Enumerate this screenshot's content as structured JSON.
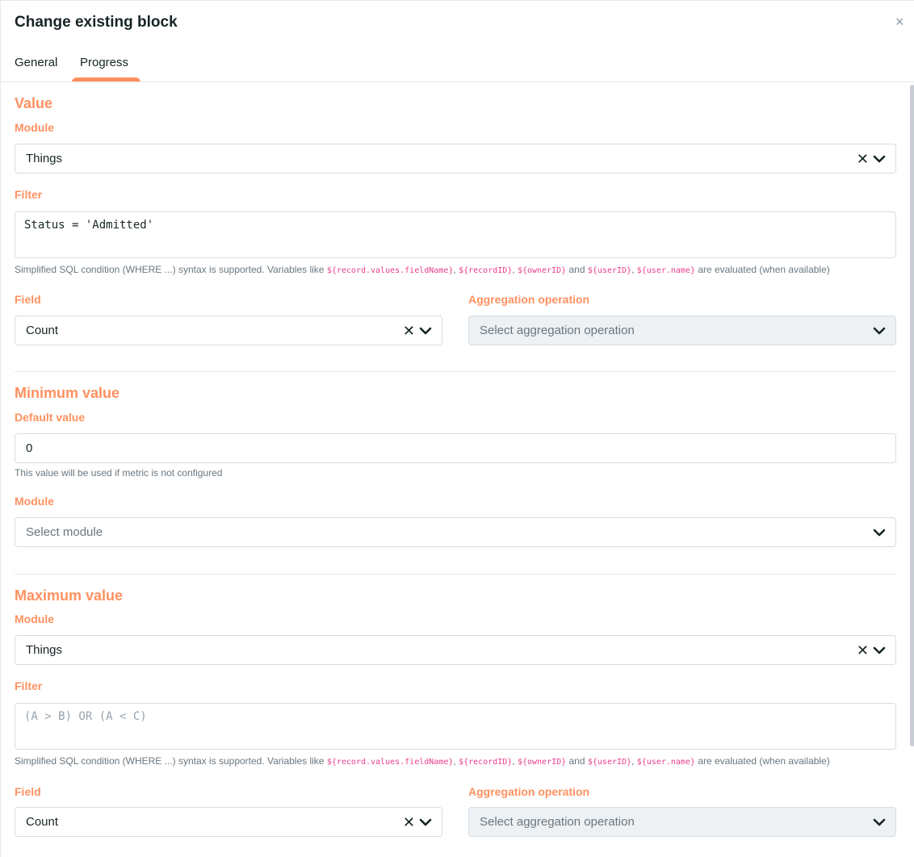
{
  "modal": {
    "title": "Change existing block",
    "close_label": "×"
  },
  "tabs": [
    {
      "label": "General"
    },
    {
      "label": "Progress",
      "active": true
    }
  ],
  "colors": {
    "accent": "#ff9160",
    "text": "#162425",
    "muted": "#6a7780",
    "code": "#e83e8c"
  },
  "value_section": {
    "title": "Value",
    "module_label": "Module",
    "module_value": "Things",
    "filter_label": "Filter",
    "filter_value": "Status = 'Admitted'",
    "help": {
      "prefix": "Simplified SQL condition (WHERE ...) syntax is supported. Variables like ",
      "var1": "${record.values.fieldName}",
      "sep1": ", ",
      "var2": "${recordID}",
      "sep2": ", ",
      "var3": "${ownerID}",
      "and": " and ",
      "var4": "${userID}",
      "sep3": ", ",
      "var5": "${user.name}",
      "suffix": " are evaluated (when available)"
    },
    "field_label": "Field",
    "field_value": "Count",
    "aggregation_label": "Aggregation operation",
    "aggregation_placeholder": "Select aggregation operation"
  },
  "minimum_section": {
    "title": "Minimum value",
    "default_label": "Default value",
    "default_value": "0",
    "default_help": "This value will be used if metric is not configured",
    "module_label": "Module",
    "module_placeholder": "Select module"
  },
  "maximum_section": {
    "title": "Maximum value",
    "module_label": "Module",
    "module_value": "Things",
    "filter_label": "Filter",
    "filter_placeholder": "(A > B) OR (A < C)",
    "help": {
      "prefix": "Simplified SQL condition (WHERE ...) syntax is supported. Variables like ",
      "var1": "${record.values.fieldName}",
      "sep1": ", ",
      "var2": "${recordID}",
      "sep2": ", ",
      "var3": "${ownerID}",
      "and": " and ",
      "var4": "${userID}",
      "sep3": ", ",
      "var5": "${user.name}",
      "suffix": " are evaluated (when available)"
    },
    "field_label": "Field",
    "field_value": "Count",
    "aggregation_label": "Aggregation operation",
    "aggregation_placeholder": "Select aggregation operation"
  },
  "icons": {
    "clear": "x-icon",
    "dropdown": "chevron-down-icon",
    "close": "close-icon"
  }
}
